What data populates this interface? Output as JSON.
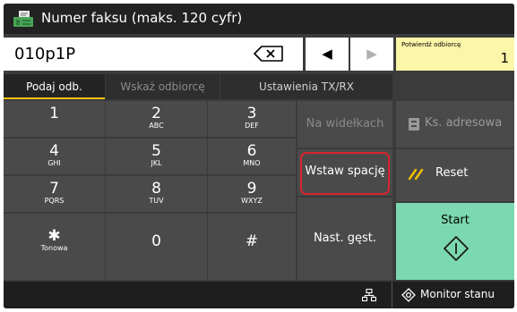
{
  "title_bar": {
    "title": "Numer faksu (maks. 120 cyfr)",
    "icon": "fax-icon"
  },
  "number_input": {
    "value": "010p1P"
  },
  "confirm_box": {
    "label": "Potwierdź odbiorcę",
    "count": "1"
  },
  "cursor": {
    "left": "◀",
    "right": "▶"
  },
  "tabs": [
    {
      "label": "Podaj odb.",
      "active": true
    },
    {
      "label": "Wskaż odbiorcę",
      "active": false
    },
    {
      "label": "Ustawienia TX/RX",
      "active": false
    }
  ],
  "keypad": [
    {
      "digit": "1",
      "letters": ""
    },
    {
      "digit": "2",
      "letters": "ABC"
    },
    {
      "digit": "3",
      "letters": "DEF"
    },
    {
      "digit": "4",
      "letters": "GHI"
    },
    {
      "digit": "5",
      "letters": "JKL"
    },
    {
      "digit": "6",
      "letters": "MNO"
    },
    {
      "digit": "7",
      "letters": "PQRS"
    },
    {
      "digit": "8",
      "letters": "TUV"
    },
    {
      "digit": "9",
      "letters": "WXYZ"
    },
    {
      "digit": "✱",
      "letters": "Tonowa"
    },
    {
      "digit": "0",
      "letters": ""
    },
    {
      "digit": "#",
      "letters": ""
    }
  ],
  "side_buttons": {
    "on_hook": "Na widełkach",
    "insert_space": "Wstaw spację",
    "next_digit": "Nast. gęst."
  },
  "right_panel": {
    "address_book": "Ks. adresowa",
    "reset": "Reset",
    "start": "Start"
  },
  "status_bar": {
    "monitor": "Monitor stanu"
  },
  "colors": {
    "highlight": "#d9242e",
    "start": "#7bd8b0",
    "confirm": "#fbf6a8",
    "tab_underline": "#f2c200"
  }
}
